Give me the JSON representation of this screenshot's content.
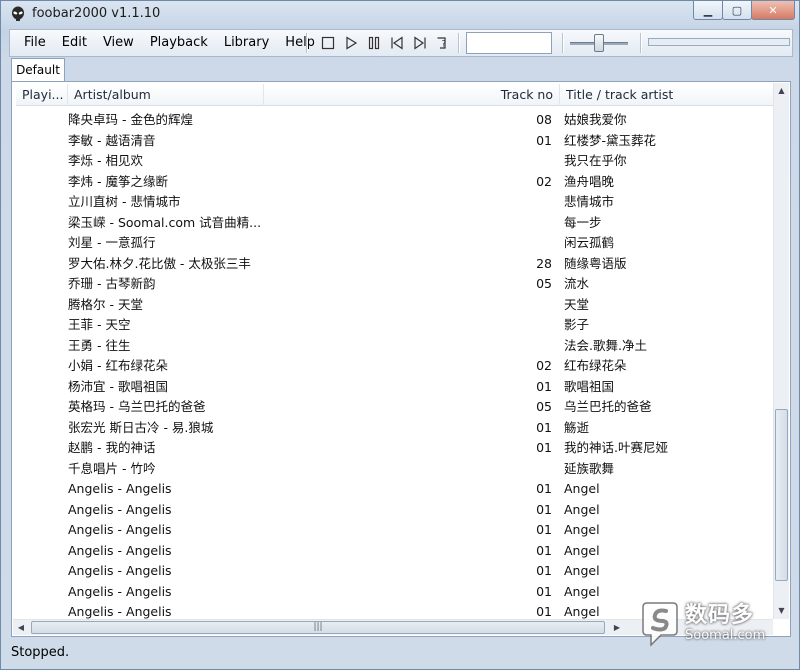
{
  "window": {
    "title": "foobar2000 v1.1.10"
  },
  "menu": [
    "File",
    "Edit",
    "View",
    "Playback",
    "Library",
    "Help"
  ],
  "tabs": [
    {
      "label": "Default"
    }
  ],
  "columns": {
    "playing": "Playi...",
    "artist_album": "Artist/album",
    "track_no": "Track no",
    "title": "Title / track artist"
  },
  "rows": [
    {
      "artist_album": "降央卓玛 - 金色的辉煌",
      "track": "08",
      "title": "姑娘我爱你"
    },
    {
      "artist_album": "李敏 - 越语清音",
      "track": "01",
      "title": "红楼梦-黛玉葬花"
    },
    {
      "artist_album": "李烁 - 相见欢",
      "track": "",
      "title": "我只在乎你"
    },
    {
      "artist_album": "李炜 - 魔筝之缘断",
      "track": "02",
      "title": "渔舟唱晚"
    },
    {
      "artist_album": "立川直树 - 悲情城市",
      "track": "",
      "title": "悲情城市"
    },
    {
      "artist_album": "梁玉嵘 - Soomal.com 试音曲精...",
      "track": "",
      "title": "每一步"
    },
    {
      "artist_album": "刘星 - 一意孤行",
      "track": "",
      "title": "闲云孤鹤"
    },
    {
      "artist_album": "罗大佑.林夕.花比傲 - 太极张三丰",
      "track": "28",
      "title": "随缘粤语版"
    },
    {
      "artist_album": "乔珊 - 古琴新韵",
      "track": "05",
      "title": "流水"
    },
    {
      "artist_album": "腾格尔 - 天堂",
      "track": "",
      "title": "天堂"
    },
    {
      "artist_album": "王菲 - 天空",
      "track": "",
      "title": "影子"
    },
    {
      "artist_album": "王勇 - 往生",
      "track": "",
      "title": "法会.歌舞.净土"
    },
    {
      "artist_album": "小娟 - 红布绿花朵",
      "track": "02",
      "title": "红布绿花朵"
    },
    {
      "artist_album": "杨沛宜 - 歌唱祖国",
      "track": "01",
      "title": "歌唱祖国"
    },
    {
      "artist_album": "英格玛 - 乌兰巴托的爸爸",
      "track": "05",
      "title": "乌兰巴托的爸爸"
    },
    {
      "artist_album": "张宏光 斯日古冷 - 易.狼城",
      "track": "01",
      "title": "觞逝"
    },
    {
      "artist_album": "赵鹏 - 我的神话",
      "track": "01",
      "title": "我的神话.叶赛尼娅"
    },
    {
      "artist_album": "千息唱片 - 竹吟",
      "track": "",
      "title": "延族歌舞"
    },
    {
      "artist_album": "Angelis - Angelis",
      "track": "01",
      "title": "Angel"
    },
    {
      "artist_album": "Angelis - Angelis",
      "track": "01",
      "title": "Angel"
    },
    {
      "artist_album": "Angelis - Angelis",
      "track": "01",
      "title": "Angel"
    },
    {
      "artist_album": "Angelis - Angelis",
      "track": "01",
      "title": "Angel"
    },
    {
      "artist_album": "Angelis - Angelis",
      "track": "01",
      "title": "Angel"
    },
    {
      "artist_album": "Angelis - Angelis",
      "track": "01",
      "title": "Angel"
    },
    {
      "artist_album": "Angelis - Angelis",
      "track": "01",
      "title": "Angel"
    }
  ],
  "status": "Stopped.",
  "watermark": {
    "cn": "数码多",
    "en": "Soomal.com"
  },
  "icons": {
    "app": "alien-icon",
    "stop": "stop-icon",
    "play": "play-icon",
    "pause": "pause-icon",
    "prev": "previous-icon",
    "next": "next-icon",
    "random": "random-icon"
  },
  "colors": {
    "frame": "#c4d3e5",
    "border": "#8ea3bb",
    "close": "#d67a63"
  }
}
